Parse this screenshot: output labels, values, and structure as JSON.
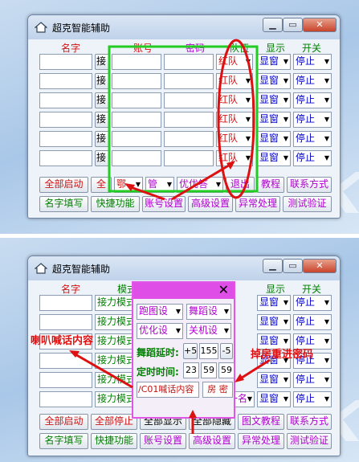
{
  "window": {
    "title": "超克智能辅助",
    "close_glyph": "✕",
    "min_glyph": "▁",
    "max_glyph": "▭"
  },
  "headers": {
    "name": "名字",
    "account": "账号",
    "password": "密码",
    "team": "队伍",
    "display": "显示",
    "switch": "开关",
    "mode": "模式"
  },
  "row_button": "接",
  "team_option": "红队",
  "display_option": "显窗",
  "switch_option": "停止",
  "relay_mode": "接力模式",
  "row_count": 6,
  "top": {
    "bottom_row1": [
      "全部启动",
      "全",
      "鄂",
      "管",
      "优优答",
      "退出",
      "教程",
      "联系方式"
    ],
    "bottom_row2": [
      "名字填写",
      "快捷功能",
      "账号设置",
      "高级设置",
      "异常处理",
      "测试验证"
    ]
  },
  "bottom": {
    "bottom_row1": [
      "全部启动",
      "全部停止",
      "全部显示",
      "全部隐藏",
      "图文教程",
      "联系方式"
    ],
    "bottom_row2": [
      "名字填写",
      "快捷功能",
      "账号设置",
      "高级设置",
      "异常处理",
      "测试验证"
    ],
    "last_row_extra": [
      "接力",
      "第一名"
    ],
    "popup": {
      "close": "✕",
      "dd1": "跑图设",
      "dd2": "舞蹈设",
      "dd3": "优化设",
      "dd4": "关机设",
      "dance_delay_label": "舞蹈延时:",
      "plus5": "+5",
      "delay_value": "155",
      "minus5": "-5",
      "timer_label": "定时时间:",
      "hh": "23",
      "mm": "59",
      "ss": "59",
      "shout_input": "/C01喊话内容",
      "room_pw": "房 密"
    }
  },
  "annotations": {
    "shout": "喇叭喊话内容",
    "room_rejoin": "掉房重进密码"
  }
}
